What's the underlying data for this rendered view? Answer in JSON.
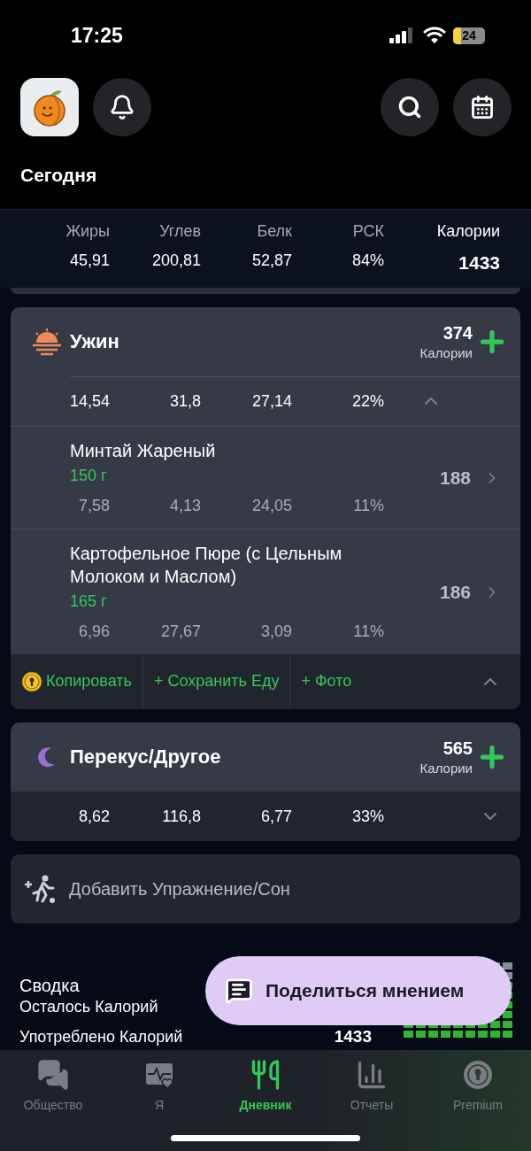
{
  "status_bar": {
    "time": "17:25",
    "battery": "24"
  },
  "header": {
    "title": "Сегодня"
  },
  "totals": [
    {
      "label": "Жиры",
      "value": "45,91",
      "kind": "macro"
    },
    {
      "label": "Углев",
      "value": "200,81",
      "kind": "macro"
    },
    {
      "label": "Белк",
      "value": "52,87",
      "kind": "macro"
    },
    {
      "label": "РСК",
      "value": "84%",
      "kind": "macro"
    },
    {
      "label": "Калории",
      "value": "1433",
      "kind": "calories"
    }
  ],
  "meals": [
    {
      "name": "Ужин",
      "kind": "sunset",
      "calories": "374",
      "calories_label": "Калории",
      "totals": [
        "14,54",
        "31,8",
        "27,14",
        "22%"
      ],
      "expanded": true,
      "foods": [
        {
          "name": "Минтай Жареный",
          "amount": "150 г",
          "calories": "188",
          "macros": [
            "7,58",
            "4,13",
            "24,05",
            "11%"
          ]
        },
        {
          "name": "Картофельное Пюре (с Цельным Молоком и Маслом)",
          "amount": "165 г",
          "calories": "186",
          "macros": [
            "6,96",
            "27,67",
            "3,09",
            "11%"
          ]
        }
      ],
      "actions": [
        {
          "label": "Копировать",
          "locked": true
        },
        {
          "label": "+ Сохранить Еду",
          "locked": false
        },
        {
          "label": "+ Фото",
          "locked": false
        }
      ]
    },
    {
      "name": "Перекус/Другое",
      "kind": "moon",
      "calories": "565",
      "calories_label": "Калории",
      "totals": [
        "8,62",
        "116,8",
        "6,77",
        "33%"
      ],
      "expanded": false
    }
  ],
  "exercise": {
    "label": "Добавить Упражнение/Сон"
  },
  "summary": {
    "title": "Сводка",
    "rows": [
      {
        "label": "Осталось Калорий"
      },
      {
        "label": "Употреблено Калорий",
        "value": "1433"
      }
    ]
  },
  "feedback_button": {
    "label": "Поделиться мнением"
  },
  "tab_bar": [
    {
      "label": "Общество",
      "kind": "chat",
      "selected": false
    },
    {
      "label": "Я",
      "kind": "health",
      "selected": false
    },
    {
      "label": "Дневник",
      "kind": "utensils",
      "selected": true
    },
    {
      "label": "Отчеты",
      "kind": "chart",
      "selected": false
    },
    {
      "label": "Premium",
      "kind": "premium",
      "selected": false
    }
  ]
}
